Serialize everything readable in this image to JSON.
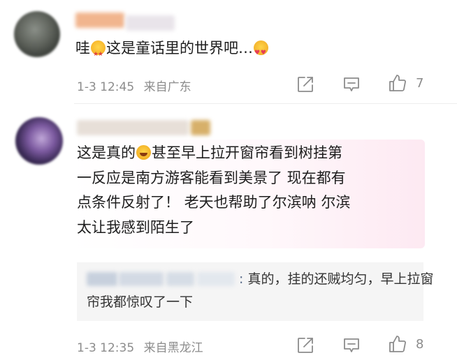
{
  "comments": [
    {
      "text_before_emoji": "哇",
      "emoji_1": "star-eyes-emoji",
      "text_after_emoji": "这是童话里的世界吧…",
      "emoji_2": "heart-eyes-emoji",
      "timestamp": "1-3 12:45",
      "location": "来自广东",
      "like_count": "7"
    },
    {
      "lines": [
        "这是真的",
        "甚至早上拉开窗帘看到树挂第",
        "一反应是南方游客能看到美景了 现在都有",
        "点条件反射了！ 老天也帮助了尔滨呐 尔滨",
        "太让我感到陌生了"
      ],
      "emoji": "laughing-emoji",
      "timestamp": "1-3 12:35",
      "location": "来自黑龙江",
      "like_count": "8",
      "reply": {
        "colon": ":",
        "line_1": " 真的，挂的还贼均匀，早上拉窗",
        "line_2": "帘我都惊叹了一下"
      }
    }
  ],
  "icons": {
    "share": "share-icon",
    "reply": "comment-icon",
    "like": "thumbs-up-icon"
  },
  "colors": {
    "meta_text": "#8c8c8c",
    "bubble_tint": "#fde9f2",
    "reply_background": "#f5f5f5"
  }
}
